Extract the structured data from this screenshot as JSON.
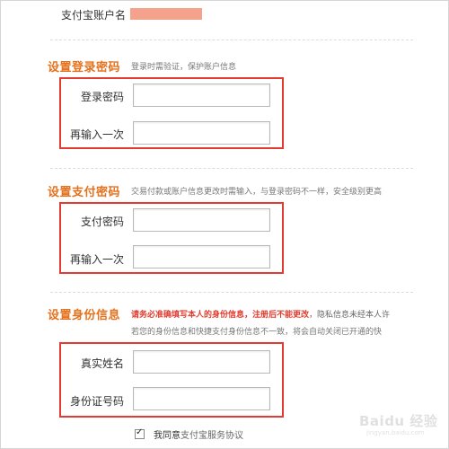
{
  "account": {
    "label": "支付宝账户名"
  },
  "login_section": {
    "title": "设置登录密码",
    "description": "登录时需验证，保护账户信息",
    "fields": [
      {
        "label": "登录密码",
        "value": ""
      },
      {
        "label": "再输入一次",
        "value": ""
      }
    ]
  },
  "pay_section": {
    "title": "设置支付密码",
    "description": "交易付款或账户信息更改时需输入，与登录密码不一样，安全级别更高",
    "fields": [
      {
        "label": "支付密码",
        "value": ""
      },
      {
        "label": "再输入一次",
        "value": ""
      }
    ]
  },
  "id_section": {
    "title": "设置身份信息",
    "desc_red": "请务必准确填写本人的身份信息，注册后不能更改",
    "desc_rest": "，隐私信息未经本人许",
    "desc_line2": "若您的身份信息和快捷支付身份信息不一致，将会自动关闭已开通的快",
    "fields": [
      {
        "label": "真实姓名",
        "value": ""
      },
      {
        "label": "身份证号码",
        "value": ""
      }
    ]
  },
  "agreement": {
    "prefix": "我同意",
    "link": "支付宝服务协议",
    "checked": true
  },
  "watermark": {
    "text": "Baidu 经验",
    "sub": "jingyan.baidu.com"
  },
  "colors": {
    "accent": "#e5711d",
    "highlight_box": "#e23b32",
    "redacted": "#f4a28c"
  }
}
